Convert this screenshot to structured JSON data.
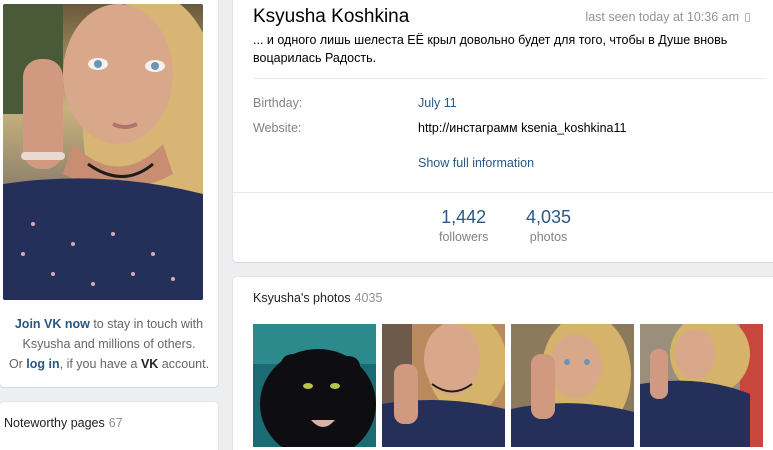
{
  "profile": {
    "name": "Ksyusha Koshkina",
    "last_seen": "last seen today at 10:36 am",
    "status": "... и одного лишь шелеста ЕЁ крыл довольно будет для того, чтобы в Душе вновь воцарилась Радость.",
    "birthday_label": "Birthday:",
    "birthday_value": "July 11",
    "website_label": "Website:",
    "website_value": "http://инстаграмм ksenia_koshkina11",
    "show_full": "Show full information"
  },
  "counters": [
    {
      "value": "1,442",
      "label": "followers"
    },
    {
      "value": "4,035",
      "label": "photos"
    }
  ],
  "join": {
    "join_link": "Join VK now",
    "text1": " to stay in touch with Ksyusha and millions of others.",
    "or": "Or ",
    "login_link": "log in",
    "text2": ", if you have a ",
    "vk": "VK",
    "text3": " account."
  },
  "noteworthy": {
    "title": "Noteworthy pages",
    "count": "67"
  },
  "photos": {
    "title": "Ksyusha's photos",
    "count": "4035"
  },
  "colors": {
    "link": "#2a5885",
    "muted": "#828282",
    "background": "#edeef0"
  }
}
